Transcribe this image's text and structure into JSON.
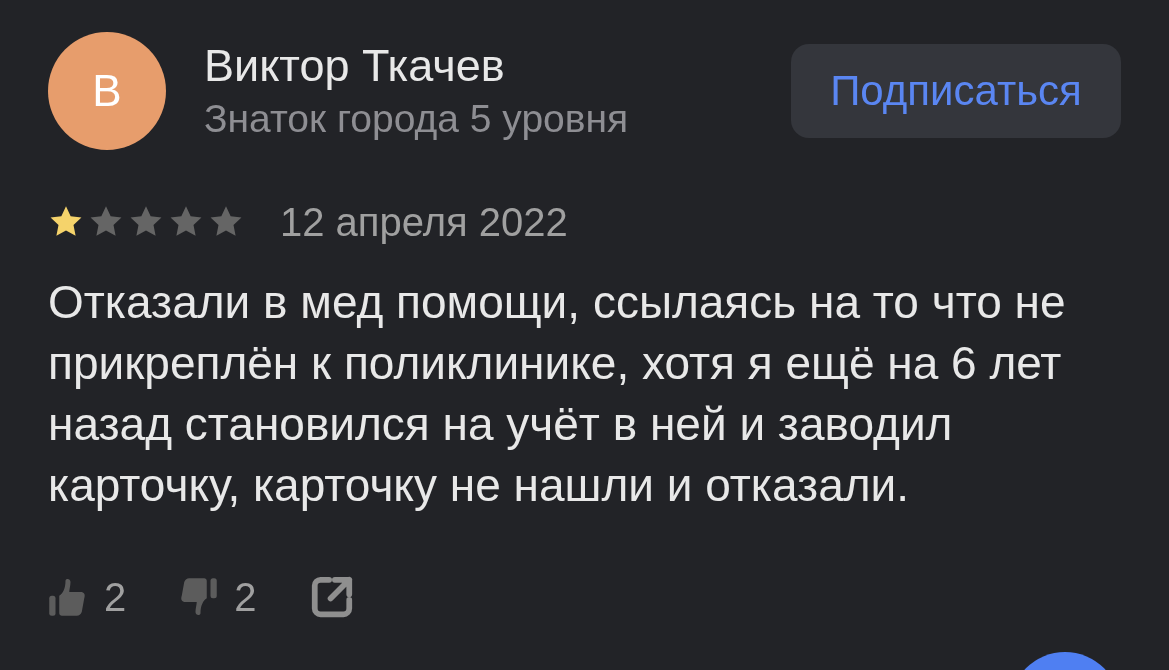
{
  "review": {
    "avatar_letter": "В",
    "author": "Виктор Ткачев",
    "author_level": "Знаток города 5 уровня",
    "subscribe_button": "Подписаться",
    "stars": 1,
    "date": "12 апреля 2022",
    "text": "Отказали в мед помощи, ссылаясь на то что не\nприкреплён к поликлинике, хотя я ещё на 6 лет\nназад становился на учёт в ней и заводил\nкарточку, карточку не нашли и отказали.",
    "likes": "2",
    "dislikes": "2"
  }
}
